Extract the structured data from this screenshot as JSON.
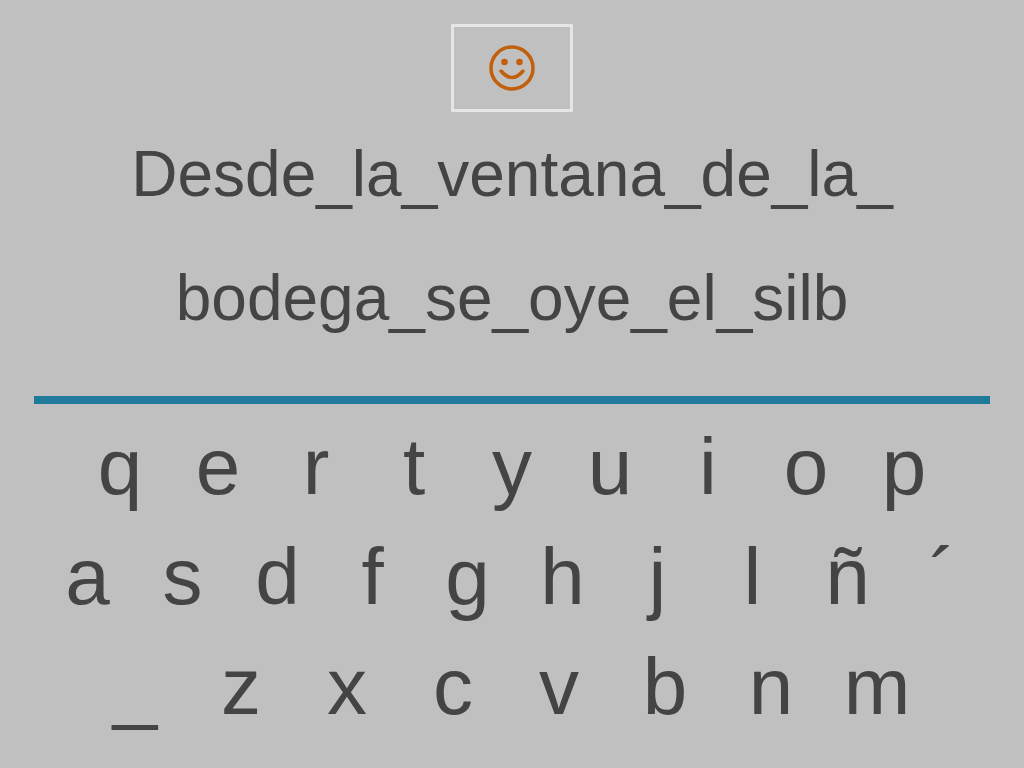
{
  "sentence": {
    "lines": [
      "Desde_la_ventana_de_la_",
      "bodega_se_oye_el_silb"
    ]
  },
  "keyboard": {
    "rows": [
      [
        "q",
        "e",
        "r",
        "t",
        "y",
        "u",
        "i",
        "o",
        "p"
      ],
      [
        "a",
        "s",
        "d",
        "f",
        "g",
        "h",
        "j",
        "l",
        "ñ",
        "´"
      ],
      [
        "_",
        "z",
        "x",
        "c",
        "v",
        "b",
        "n",
        "m"
      ]
    ]
  }
}
